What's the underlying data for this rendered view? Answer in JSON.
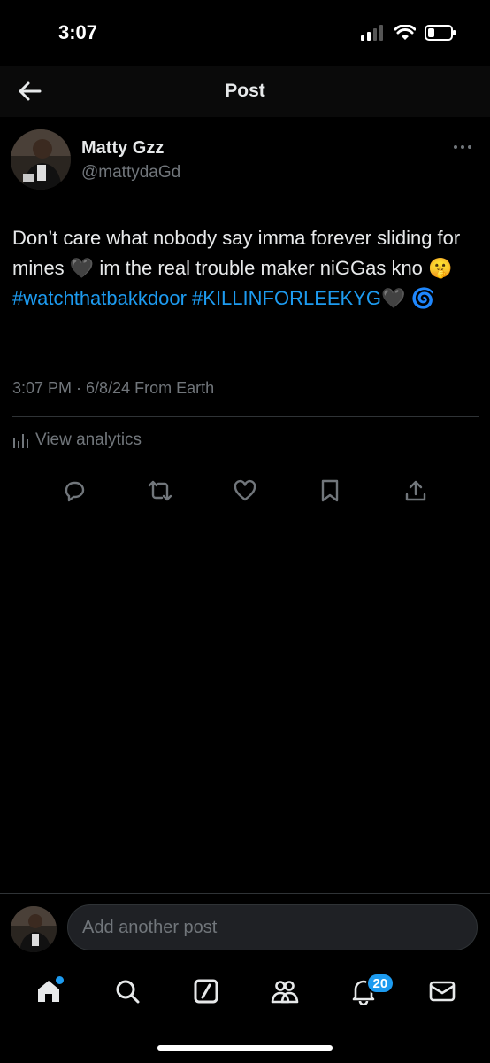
{
  "status_bar": {
    "time": "3:07"
  },
  "header": {
    "title": "Post"
  },
  "post": {
    "author_name": "Matty Gzz",
    "author_handle": "@mattydaGd",
    "text_part1": "Don’t care what nobody say imma forever sliding for mines ",
    "heart1": "🖤",
    "text_part2": " im the real trouble maker niGGas kno ",
    "emoji_shush": "🤫",
    "hashtag1": "#watchthatbakkdoor",
    "hashtag2": "#KILLINFORLEEKYG",
    "heart2": "🖤",
    "emoji_swirl": "🌀",
    "meta": "3:07 PM · 6/8/24 From Earth",
    "analytics_label": "View analytics"
  },
  "reply": {
    "placeholder": "Add another post"
  },
  "tabbar": {
    "notifications_badge": "20"
  },
  "colors": {
    "accent": "#1d9bf0",
    "muted": "#71767b",
    "background": "#000000"
  }
}
